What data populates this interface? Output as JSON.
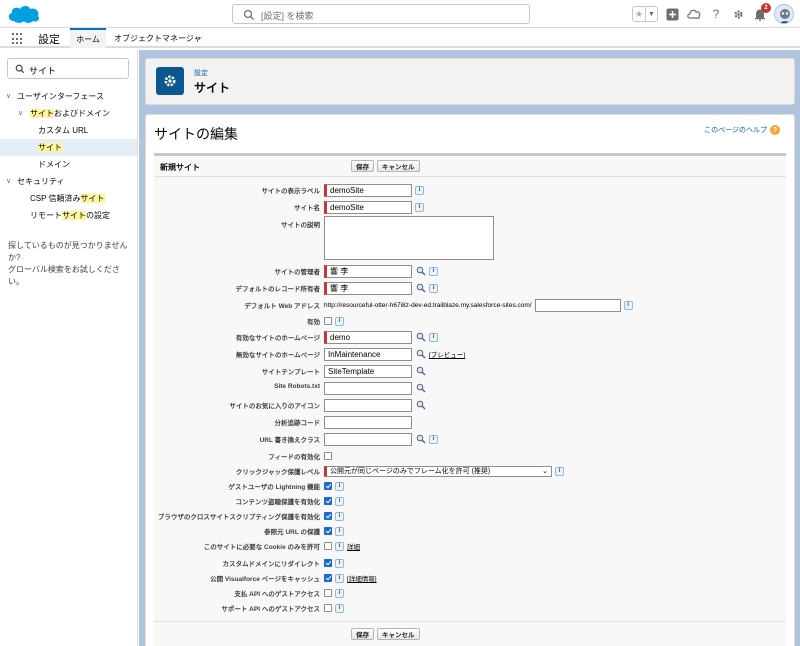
{
  "header": {
    "search_placeholder": "[設定] を検索",
    "notification_count": "2"
  },
  "nav": {
    "app_title": "設定",
    "tabs": [
      {
        "label": "ホーム"
      },
      {
        "label": "オブジェクトマネージャ"
      }
    ]
  },
  "sidebar": {
    "quick_find_value": "サイト",
    "items": [
      {
        "label": "ユーザインターフェース"
      },
      {
        "label_hl": "サイト",
        "label_rest": "およびドメイン"
      },
      {
        "label": "カスタム URL"
      },
      {
        "label_hl": "サイト"
      },
      {
        "label": "ドメイン"
      },
      {
        "label": "セキュリティ"
      },
      {
        "label_pre": "CSP 信頼済み",
        "label_hl": "サイト"
      },
      {
        "label_pre": "リモート",
        "label_hl": "サイト",
        "label_rest": "の設定"
      }
    ],
    "help_line1": "探しているものが見つかりませんか?",
    "help_line2": "グローバル検索をお試しください。"
  },
  "page_header": {
    "breadcrumb": "設定",
    "title": "サイト"
  },
  "content": {
    "title": "サイトの編集",
    "help_link": "このページのヘルプ",
    "section_title": "新規サイト",
    "save_label": "保存",
    "cancel_label": "キャンセル"
  },
  "form": {
    "display_label": {
      "label": "サイトの表示ラベル",
      "value": "demoSite"
    },
    "site_name": {
      "label": "サイト名",
      "value": "demoSite"
    },
    "description": {
      "label": "サイトの説明"
    },
    "site_admin": {
      "label": "サイトの管理者",
      "value": "響 李"
    },
    "default_owner": {
      "label": "デフォルトのレコード所有者",
      "value": "響 李"
    },
    "web_address": {
      "label": "デフォルト Web アドレス",
      "prefix": "http://resourceful-otter-h67i8z-dev-ed.trailblaze.my.salesforce-sites.com/"
    },
    "active": {
      "label": "有効"
    },
    "active_home": {
      "label": "有効なサイトのホームページ",
      "value": "demo"
    },
    "inactive_home": {
      "label": "無効なサイトのホームページ",
      "value": "InMaintenance",
      "preview": "[プレビュー]"
    },
    "template": {
      "label": "サイトテンプレート",
      "value": "SiteTemplate"
    },
    "robots": {
      "label": "Site Robots.txt"
    },
    "favicon": {
      "label": "サイトのお気に入りのアイコン"
    },
    "analytics": {
      "label": "分析追跡コード"
    },
    "url_rewriter": {
      "label": "URL 書き換えクラス"
    },
    "feeds": {
      "label": "フィードの有効化"
    },
    "clickjack": {
      "label": "クリックジャック保護レベル",
      "value": "公開元が同じページのみでフレーム化を許可 (推奨)"
    },
    "lightning": {
      "label": "ゲストユーザの Lightning 機能"
    },
    "content_sniff": {
      "label": "コンテンツ盗聴保護を有効化"
    },
    "xss": {
      "label": "ブラウザのクロスサイトスクリプティング保護を有効化"
    },
    "referrer": {
      "label": "参照元 URL の保護"
    },
    "cookies": {
      "label": "このサイトに必要な Cookie のみを許可",
      "detail": "詳細"
    },
    "redirect": {
      "label": "カスタムドメインにリダイレクト"
    },
    "vf_cache": {
      "label": "公開 Visualforce ページをキャッシュ",
      "detail": "[詳細情報]"
    },
    "payment_api": {
      "label": "支払 API へのゲストアクセス"
    },
    "support_api": {
      "label": "サポート API へのゲストアクセス"
    }
  },
  "icons": {
    "brand_color": "#00a1e0",
    "accent": "#0176d3"
  }
}
